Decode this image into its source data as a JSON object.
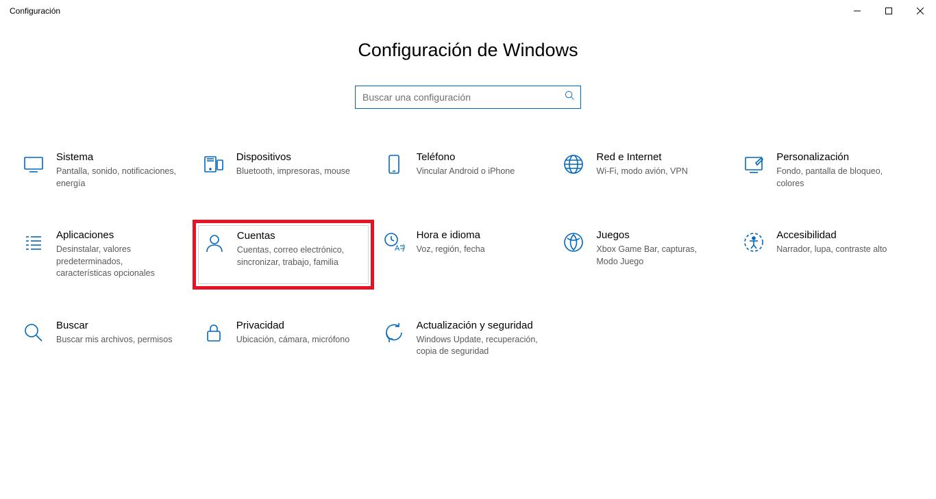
{
  "window": {
    "title": "Configuración"
  },
  "header": {
    "title": "Configuración de Windows"
  },
  "search": {
    "placeholder": "Buscar una configuración"
  },
  "tiles": {
    "sistema": {
      "title": "Sistema",
      "desc": "Pantalla, sonido, notificaciones, energía"
    },
    "dispositivos": {
      "title": "Dispositivos",
      "desc": "Bluetooth, impresoras, mouse"
    },
    "telefono": {
      "title": "Teléfono",
      "desc": "Vincular Android o iPhone"
    },
    "red": {
      "title": "Red e Internet",
      "desc": "Wi-Fi, modo avión, VPN"
    },
    "personalizacion": {
      "title": "Personalización",
      "desc": "Fondo, pantalla de bloqueo, colores"
    },
    "aplicaciones": {
      "title": "Aplicaciones",
      "desc": "Desinstalar, valores predeterminados, características opcionales"
    },
    "cuentas": {
      "title": "Cuentas",
      "desc": "Cuentas, correo electrónico, sincronizar, trabajo, familia"
    },
    "hora": {
      "title": "Hora e idioma",
      "desc": "Voz, región, fecha"
    },
    "juegos": {
      "title": "Juegos",
      "desc": "Xbox Game Bar, capturas, Modo Juego"
    },
    "accesibilidad": {
      "title": "Accesibilidad",
      "desc": "Narrador, lupa, contraste alto"
    },
    "buscar": {
      "title": "Buscar",
      "desc": "Buscar mis archivos, permisos"
    },
    "privacidad": {
      "title": "Privacidad",
      "desc": "Ubicación, cámara, micrófono"
    },
    "actualizacion": {
      "title": "Actualización y seguridad",
      "desc": "Windows Update, recuperación, copia de seguridad"
    }
  }
}
